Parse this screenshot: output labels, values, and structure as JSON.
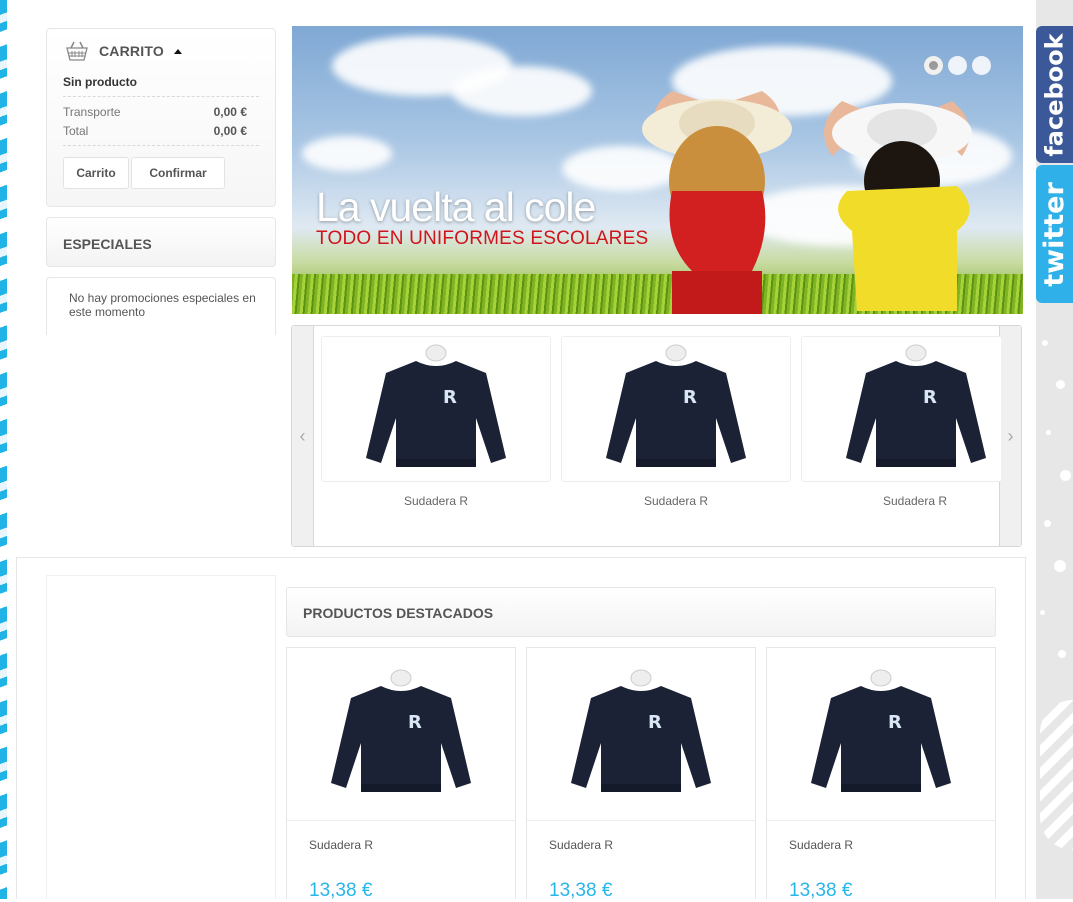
{
  "cart": {
    "title": "CARRITO",
    "empty_text": "Sin producto",
    "shipping_label": "Transporte",
    "shipping_value": "0,00 €",
    "total_label": "Total",
    "total_value": "0,00 €",
    "cart_button": "Carrito",
    "confirm_button": "Confirmar"
  },
  "specials": {
    "title": "ESPECIALES",
    "message": "No hay promociones especiales en este momento"
  },
  "banner": {
    "title": "La  vuelta al cole",
    "subtitle": "TODO EN UNIFORMES ESCOLARES",
    "slide_count": 3,
    "active_slide": 1
  },
  "carousel": {
    "items": [
      {
        "name": "Sudadera R"
      },
      {
        "name": "Sudadera R"
      },
      {
        "name": "Sudadera R"
      }
    ]
  },
  "featured": {
    "title": "PRODUCTOS DESTACADOS",
    "items": [
      {
        "name": "Sudadera R",
        "price": "13,38 €"
      },
      {
        "name": "Sudadera R",
        "price": "13,38 €"
      },
      {
        "name": "Sudadera R",
        "price": "13,38 €"
      }
    ]
  },
  "social": {
    "facebook": "facebook",
    "twitter": "twitter"
  },
  "colors": {
    "price": "#27b6ea",
    "facebook": "#3b5998",
    "twitter": "#2fb0e8",
    "banner_subtitle": "#d0141b"
  }
}
